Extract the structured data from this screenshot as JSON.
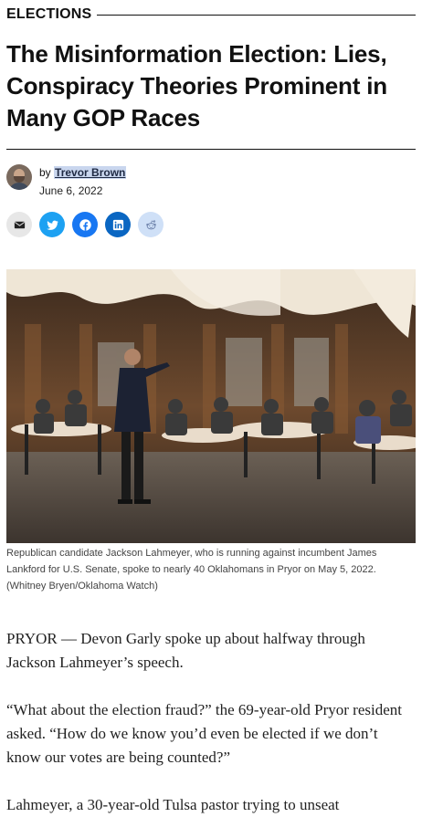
{
  "section": "ELECTIONS",
  "headline": "The Misinformation Election: Lies, Conspiracy Theories Prominent in Many GOP Races",
  "byline": {
    "prefix": "by",
    "author": "Trevor Brown",
    "date": "June 6, 2022"
  },
  "share_icons": [
    "email-icon",
    "twitter-icon",
    "facebook-icon",
    "linkedin-icon",
    "reddit-icon"
  ],
  "colors": {
    "twitter": "#1da1f2",
    "facebook": "#1877f2",
    "linkedin": "#0a66c2",
    "reddit_bg": "#cfe0f7",
    "author_highlight": "#c9d6ee"
  },
  "photo": {
    "caption": "Republican candidate Jackson Lahmeyer, who is running against incumbent James Lankford for U.S. Senate, spoke to nearly 40 Oklahomans in Pryor on May 5, 2022. (Whitney Bryen/Oklahoma Watch)"
  },
  "paragraphs": [
    "PRYOR — Devon Garly spoke up about halfway through Jackson Lahmeyer’s speech.",
    "“What about the election fraud?” the 69-year-old Pryor resident asked. “How do we know you’d even be elected if we don’t know our votes are being counted?”",
    "Lahmeyer, a 30-year-old Tulsa pastor trying to unseat"
  ]
}
